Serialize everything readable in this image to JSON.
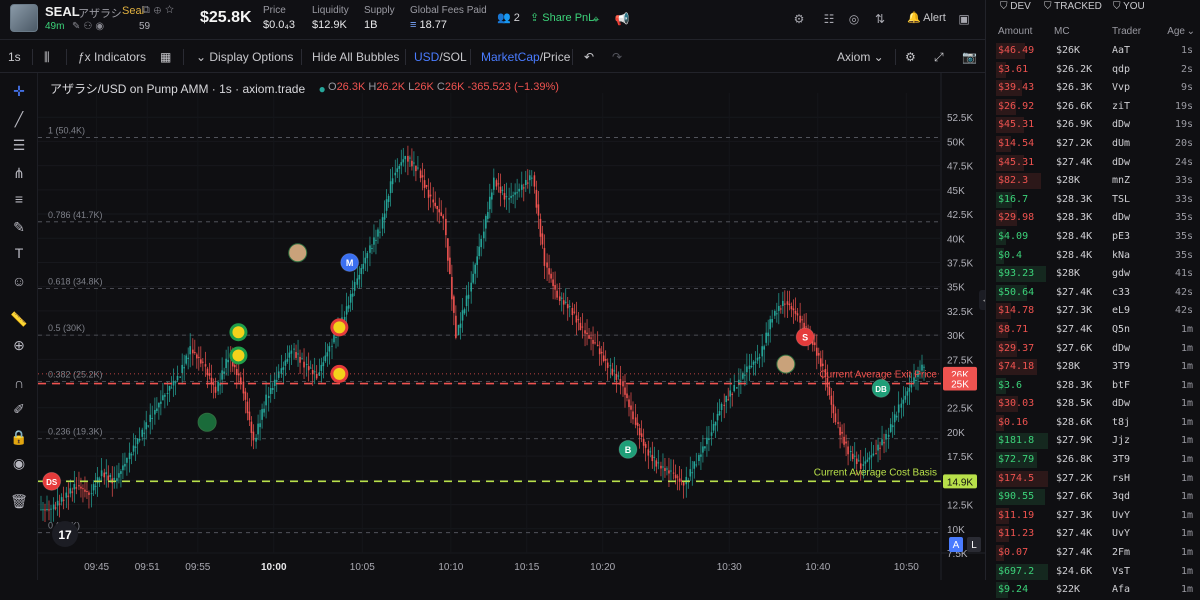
{
  "token": {
    "symbol": "SEAL",
    "name_jp": "アザラシ",
    "seal_label": "Seal",
    "age": "49m",
    "holders": "59",
    "market_cap": "$25.8K"
  },
  "stats": [
    {
      "label": "Price",
      "value": "$0.0₄3"
    },
    {
      "label": "Liquidity",
      "value": "$12.9K"
    },
    {
      "label": "Supply",
      "value": "1B"
    },
    {
      "label": "Global Fees Paid",
      "value": "18.77"
    }
  ],
  "header": {
    "watchers": "2",
    "share_label": "Share PnL",
    "alert_label": "Alert"
  },
  "toolbar": {
    "interval": "1s",
    "indicators": "Indicators",
    "display_options": "Display Options",
    "hide_bubbles": "Hide All Bubbles",
    "currency_usd": "USD",
    "currency_sol": "/SOL",
    "mcap": "MarketCap",
    "price": "/Price",
    "source": "Axiom"
  },
  "chart_header": {
    "title": "アザラシ/USD on Pump AMM · 1s · axiom.trade",
    "o": "26.3K",
    "h": "26.2K",
    "l": "26K",
    "c": "26K",
    "change": "-365.523 (−1.39%)"
  },
  "chart_data": {
    "type": "candlestick",
    "y_unit": "market cap (USD)",
    "ylim": [
      7500,
      55000
    ],
    "y_ticks": [
      "52.5K",
      "50K",
      "47.5K",
      "45K",
      "42.5K",
      "40K",
      "37.5K",
      "35K",
      "32.5K",
      "30K",
      "27.5K",
      "25K",
      "22.5K",
      "20K",
      "17.5K",
      "15K",
      "12.5K",
      "10K",
      "7.5K"
    ],
    "y_tick_values": [
      52500,
      50000,
      47500,
      45000,
      42500,
      40000,
      37500,
      35000,
      32500,
      30000,
      27500,
      25000,
      22500,
      20000,
      17500,
      15000,
      12500,
      10000,
      7500
    ],
    "x_ticks": [
      "09:45",
      "09:51",
      "09:55",
      "10:00",
      "10:05",
      "10:10",
      "10:15",
      "10:20",
      "10:30",
      "10:40",
      "10:50"
    ],
    "x_tick_index": [
      4,
      8,
      12,
      18,
      25,
      32,
      38,
      44,
      54,
      61,
      68
    ],
    "close_path": [
      12000,
      13200,
      14500,
      13600,
      15800,
      14900,
      17200,
      19500,
      21800,
      24000,
      25600,
      28500,
      27000,
      24200,
      27800,
      25200,
      19000,
      23500,
      26000,
      28500,
      27000,
      25800,
      28800,
      31500,
      35200,
      38500,
      41000,
      46500,
      48500,
      47000,
      44000,
      42000,
      30000,
      34500,
      40000,
      46000,
      44000,
      45000,
      46500,
      37500,
      34000,
      32800,
      30500,
      29000,
      26800,
      25200,
      21500,
      18200,
      16500,
      15800,
      14600,
      17000,
      19600,
      22800,
      24500,
      26500,
      27800,
      32000,
      33500,
      32000,
      29800,
      26500,
      21000,
      18000,
      16500,
      17800,
      19500,
      22500,
      25000,
      27000
    ],
    "fib_levels": [
      {
        "label": "1 (50.4K)",
        "value": 50400
      },
      {
        "label": "0.786 (41.7K)",
        "value": 41700
      },
      {
        "label": "0.618 (34.8K)",
        "value": 34800
      },
      {
        "label": "0.5 (30K)",
        "value": 30000
      },
      {
        "label": "0.382 (25.2K)",
        "value": 25200
      },
      {
        "label": "0.236 (19.3K)",
        "value": 19300
      },
      {
        "label": "0 (9.6K)",
        "value": 9600
      }
    ],
    "exit_price": {
      "label": "Current Average Exit Price",
      "value": 25000
    },
    "cost_basis": {
      "label": "Current Average Cost Basis",
      "value": 14900
    },
    "price_tags": [
      {
        "label": "26K",
        "value": 26000,
        "color": "#ef5350"
      },
      {
        "label": "25K",
        "value": 25000,
        "color": "#ef5350"
      },
      {
        "label": "14.9K",
        "value": 14900,
        "color": "#b8e04a"
      }
    ],
    "markers": [
      {
        "label": "DS",
        "index": 1,
        "value": 14900,
        "color": "#e53b3b"
      },
      {
        "label": "M",
        "index": 24,
        "value": 37500,
        "color": "#3a6ff0"
      },
      {
        "label": "B",
        "index": 46,
        "value": 18200,
        "color": "#1f9e78"
      },
      {
        "label": "S",
        "index": 60,
        "value": 29800,
        "color": "#e53b3b"
      },
      {
        "label": "DB",
        "index": 66,
        "value": 24500,
        "color": "#1f9e78"
      }
    ]
  },
  "panel": {
    "tabs": [
      "DEV",
      "TRACKED",
      "YOU"
    ],
    "columns": [
      "Amount",
      "MC",
      "Trader",
      "Age"
    ],
    "trades": [
      {
        "amount": "$46.49",
        "mc": "$26K",
        "trader": "AaT",
        "age": "1s",
        "side": "sell"
      },
      {
        "amount": "$3.61",
        "mc": "$26.2K",
        "trader": "qdp",
        "age": "2s",
        "side": "sell"
      },
      {
        "amount": "$39.43",
        "mc": "$26.3K",
        "trader": "Vvp",
        "age": "9s",
        "side": "sell"
      },
      {
        "amount": "$26.92",
        "mc": "$26.6K",
        "trader": "ziT",
        "age": "19s",
        "side": "sell"
      },
      {
        "amount": "$45.31",
        "mc": "$26.9K",
        "trader": "dDw",
        "age": "19s",
        "side": "sell"
      },
      {
        "amount": "$14.54",
        "mc": "$27.2K",
        "trader": "dUm",
        "age": "20s",
        "side": "sell"
      },
      {
        "amount": "$45.31",
        "mc": "$27.4K",
        "trader": "dDw",
        "age": "24s",
        "side": "sell"
      },
      {
        "amount": "$82.3",
        "mc": "$28K",
        "trader": "mnZ",
        "age": "33s",
        "side": "sell"
      },
      {
        "amount": "$16.7",
        "mc": "$28.3K",
        "trader": "TSL",
        "age": "33s",
        "side": "buy"
      },
      {
        "amount": "$29.98",
        "mc": "$28.3K",
        "trader": "dDw",
        "age": "35s",
        "side": "sell"
      },
      {
        "amount": "$4.09",
        "mc": "$28.4K",
        "trader": "pE3",
        "age": "35s",
        "side": "buy"
      },
      {
        "amount": "$0.4",
        "mc": "$28.4K",
        "trader": "kNa",
        "age": "35s",
        "side": "buy"
      },
      {
        "amount": "$93.23",
        "mc": "$28K",
        "trader": "gdw",
        "age": "41s",
        "side": "buy"
      },
      {
        "amount": "$50.64",
        "mc": "$27.4K",
        "trader": "c33",
        "age": "42s",
        "side": "buy"
      },
      {
        "amount": "$14.78",
        "mc": "$27.3K",
        "trader": "eL9",
        "age": "42s",
        "side": "sell"
      },
      {
        "amount": "$8.71",
        "mc": "$27.4K",
        "trader": "Q5n",
        "age": "1m",
        "side": "sell"
      },
      {
        "amount": "$29.37",
        "mc": "$27.6K",
        "trader": "dDw",
        "age": "1m",
        "side": "sell"
      },
      {
        "amount": "$74.18",
        "mc": "$28K",
        "trader": "3T9",
        "age": "1m",
        "side": "sell"
      },
      {
        "amount": "$3.6",
        "mc": "$28.3K",
        "trader": "btF",
        "age": "1m",
        "side": "buy"
      },
      {
        "amount": "$30.03",
        "mc": "$28.5K",
        "trader": "dDw",
        "age": "1m",
        "side": "sell"
      },
      {
        "amount": "$0.16",
        "mc": "$28.6K",
        "trader": "t8j",
        "age": "1m",
        "side": "sell"
      },
      {
        "amount": "$181.8",
        "mc": "$27.9K",
        "trader": "Jjz",
        "age": "1m",
        "side": "buy"
      },
      {
        "amount": "$72.79",
        "mc": "$26.8K",
        "trader": "3T9",
        "age": "1m",
        "side": "buy"
      },
      {
        "amount": "$174.5",
        "mc": "$27.2K",
        "trader": "rsH",
        "age": "1m",
        "side": "sell"
      },
      {
        "amount": "$90.55",
        "mc": "$27.6K",
        "trader": "3qd",
        "age": "1m",
        "side": "buy"
      },
      {
        "amount": "$11.19",
        "mc": "$27.3K",
        "trader": "UvY",
        "age": "1m",
        "side": "sell"
      },
      {
        "amount": "$11.23",
        "mc": "$27.4K",
        "trader": "UvY",
        "age": "1m",
        "side": "sell"
      },
      {
        "amount": "$0.07",
        "mc": "$27.4K",
        "trader": "2Fm",
        "age": "1m",
        "side": "sell"
      },
      {
        "amount": "$697.2",
        "mc": "$24.6K",
        "trader": "VsT",
        "age": "1m",
        "side": "buy"
      },
      {
        "amount": "$9.24",
        "mc": "$22K",
        "trader": "Afa",
        "age": "1m",
        "side": "buy"
      }
    ]
  },
  "colors": {
    "up": "#26a69a",
    "down": "#ef5350",
    "buy": "#3cd37a",
    "sell": "#ef5350",
    "accent": "#4a7cff"
  }
}
